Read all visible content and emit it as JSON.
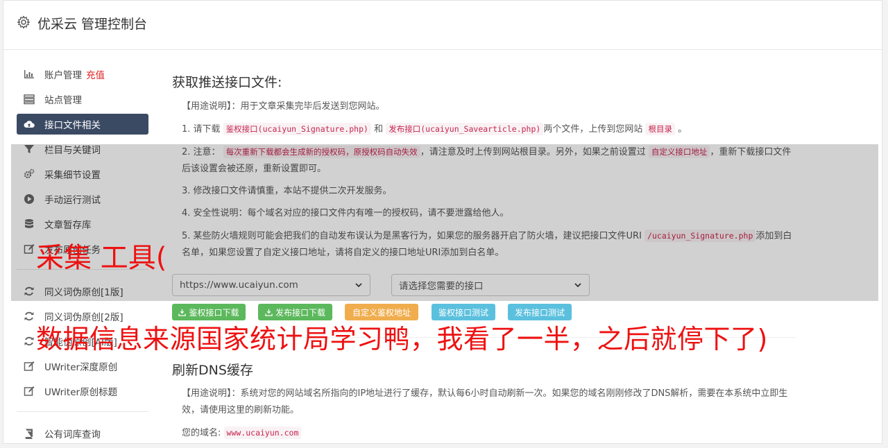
{
  "app": {
    "title": "优采云 管理控制台",
    "icon": "gear-icon"
  },
  "sidebar": {
    "items": [
      {
        "label": "账户管理",
        "extra": "充值",
        "icon": "bar-chart-icon"
      },
      {
        "label": "站点管理",
        "icon": "server-icon"
      },
      {
        "label": "接口文件相关",
        "icon": "cloud-upload-icon",
        "active": true
      },
      {
        "label": "栏目与关键词",
        "icon": "filter-icon"
      },
      {
        "label": "采集细节设置",
        "icon": "cogs-icon"
      },
      {
        "label": "手动运行测试",
        "icon": "play-circle-icon"
      },
      {
        "label": "文章暂存库",
        "icon": "database-icon"
      },
      {
        "label": "发布原创任务",
        "icon": "edit-icon"
      },
      {
        "label": "同义词伪原创[1版]",
        "icon": "refresh-icon"
      },
      {
        "label": "同义词伪原创[2版]",
        "icon": "refresh-icon"
      },
      {
        "label": "智能伪原创[AI版]",
        "icon": "refresh-icon"
      },
      {
        "label": "UWriter深度原创",
        "icon": "edit-icon"
      },
      {
        "label": "UWriter原创标题",
        "icon": "edit-icon"
      },
      {
        "label": "公有词库查询",
        "icon": "book-icon"
      }
    ]
  },
  "section1": {
    "title": "获取推送接口文件:",
    "usage": "【用途说明】：用于文章采集完毕后发送到您网站。",
    "step1": {
      "prefix": "1. 请下载",
      "code1": "鉴权接口(ucaiyun_Signature.php)",
      "mid": "和",
      "code2": "发布接口(ucaiyun_Savearticle.php)",
      "suffix": "两个文件，上传到您网站",
      "code3": "根目录",
      "end": "。"
    },
    "step2": {
      "prefix": "2. 注意：",
      "code1": "每次重新下载都会生成新的授权码，原授权码自动失效",
      "mid": "，请注意及时上传到网站根目录。另外，如果之前设置过",
      "code2": "自定义接口地址",
      "suffix": "，重新下载接口文件后该设置会被还原，重新设置即可。"
    },
    "step3": "3. 修改接口文件请慎重，本站不提供二次开发服务。",
    "step4": "4. 安全性说明：每个域名对应的接口文件内有唯一的授权码，请不要泄露给他人。",
    "step5": {
      "prefix": "5. 某些防火墙规则可能会把我们的自动发布误认为是黑客行为，如果您的服务器开启了防火墙，建议把接口文件URI",
      "code1": "/ucaiyun_Signature.php",
      "suffix": "添加到白名单，如果您设置了自定义接口地址，请将自定义的接口地址URI添加到白名单。"
    },
    "site_select": "https://www.ucaiyun.com",
    "api_select": "请选择您需要的接口",
    "buttons": {
      "download_auth": "鉴权接口下载",
      "download_publish": "发布接口下载",
      "custom_auth": "自定义鉴权地址",
      "test_auth": "鉴权接口测试",
      "test_publish": "发布接口测试"
    }
  },
  "section2": {
    "title": "刷新DNS缓存",
    "usage": "【用途说明】：系统对您的网站域名所指向的IP地址进行了缓存，默认每6小时自动刷新一次。如果您的域名刚刚修改了DNS解析，需要在本系统中立即生效，请使用这里的刷新功能。",
    "domain_label": "您的域名:",
    "domain_value": "www.ucaiyun.com"
  },
  "overlay": {
    "line1": "采集 工具(",
    "line2": "数据信息来源国家统计局学习鸭，我看了一半，之后就停下了)"
  },
  "colors": {
    "active_bg": "#3b4a63",
    "btn_green": "#5cb85c",
    "btn_orange": "#f0ad4e",
    "btn_blue": "#5bc0de",
    "code_red": "#c7254e",
    "overlay_red": "#ee1111"
  }
}
